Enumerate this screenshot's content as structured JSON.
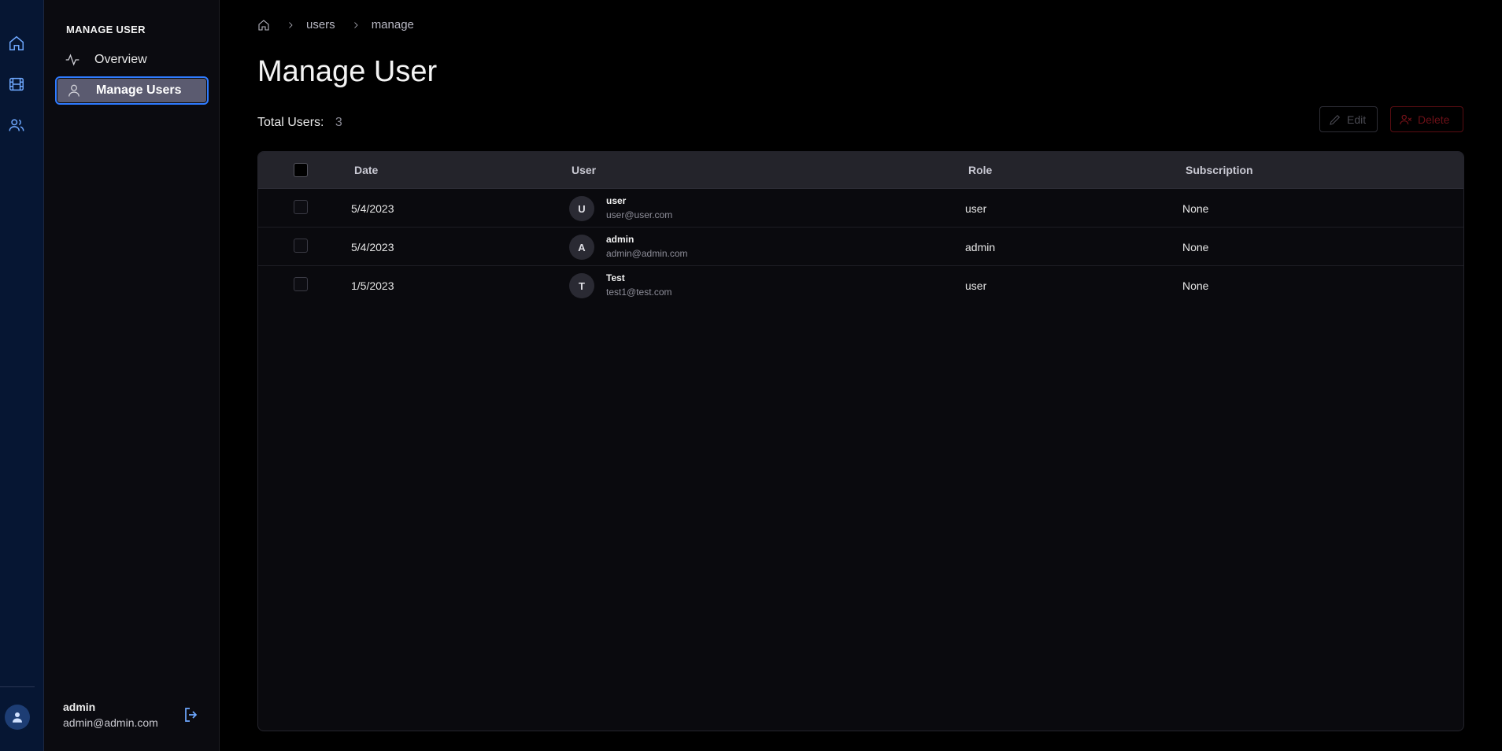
{
  "rail": {
    "icons": [
      "home-icon",
      "film-icon",
      "users-icon"
    ],
    "accent": "#6ea8ff"
  },
  "sidebar": {
    "title": "MANAGE USER",
    "items": [
      {
        "label": "Overview",
        "icon": "activity-icon",
        "active": false
      },
      {
        "label": "Manage Users",
        "icon": "user-icon",
        "active": true
      }
    ],
    "user": {
      "name": "admin",
      "email": "admin@admin.com"
    }
  },
  "breadcrumb": {
    "items": [
      "users",
      "manage"
    ]
  },
  "page": {
    "title": "Manage User",
    "total_label": "Total Users:",
    "total_count": "3"
  },
  "toolbar": {
    "edit_label": "Edit",
    "delete_label": "Delete"
  },
  "table": {
    "columns": [
      "Date",
      "User",
      "Role",
      "Subscription"
    ],
    "rows": [
      {
        "date": "5/4/2023",
        "initial": "U",
        "name": "user",
        "email": "user@user.com",
        "role": "user",
        "subscription": "None"
      },
      {
        "date": "5/4/2023",
        "initial": "A",
        "name": "admin",
        "email": "admin@admin.com",
        "role": "admin",
        "subscription": "None"
      },
      {
        "date": "1/5/2023",
        "initial": "T",
        "name": "Test",
        "email": "test1@test.com",
        "role": "user",
        "subscription": "None"
      }
    ]
  },
  "colors": {
    "background": "#000000",
    "rail": "#061633",
    "sidebar": "#0b0b10",
    "active_item": "#5b5b70",
    "focus_ring": "#2f7bff",
    "delete": "#7a1219"
  }
}
